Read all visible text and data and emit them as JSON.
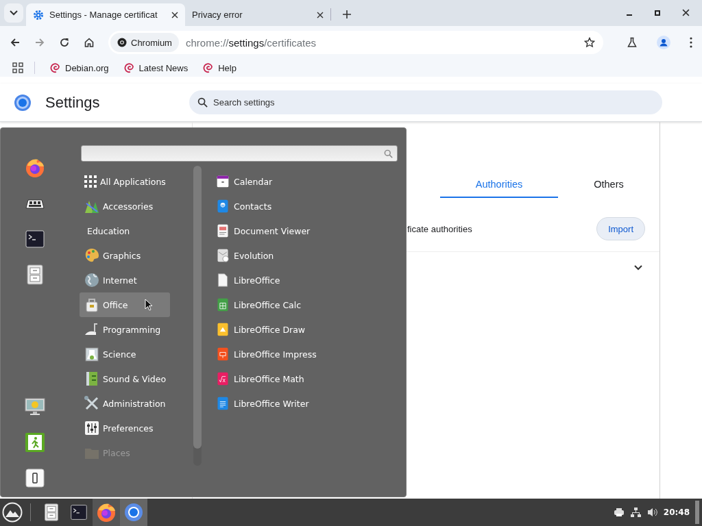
{
  "browser": {
    "tabs": [
      {
        "title": "Settings - Manage certificat",
        "selected": true
      },
      {
        "title": "Privacy error",
        "selected": false
      }
    ],
    "site_chip": "Chromium",
    "url": [
      {
        "text": "chrome://",
        "emphasis": false
      },
      {
        "text": "settings",
        "emphasis": true
      },
      {
        "text": "/certificates",
        "emphasis": false
      }
    ],
    "bookmarks": [
      "Debian.org",
      "Latest News",
      "Help"
    ]
  },
  "settings": {
    "title": "Settings",
    "search": {
      "placeholder": "Search settings"
    },
    "certificate_tabs": [
      {
        "label": "Authorities",
        "selected": true
      },
      {
        "label": "Others",
        "selected": false
      }
    ],
    "description": "ficate authorities",
    "import_button": "Import"
  },
  "menu": {
    "categories": [
      {
        "label": "All Applications",
        "selected": false,
        "disabled": false
      },
      {
        "label": "Accessories",
        "selected": false,
        "disabled": false
      },
      {
        "label": "Education",
        "selected": false,
        "disabled": false
      },
      {
        "label": "Graphics",
        "selected": false,
        "disabled": false
      },
      {
        "label": "Internet",
        "selected": false,
        "disabled": false
      },
      {
        "label": "Office",
        "selected": true,
        "disabled": false
      },
      {
        "label": "Programming",
        "selected": false,
        "disabled": false
      },
      {
        "label": "Science",
        "selected": false,
        "disabled": false
      },
      {
        "label": "Sound & Video",
        "selected": false,
        "disabled": false
      },
      {
        "label": "Administration",
        "selected": false,
        "disabled": false
      },
      {
        "label": "Preferences",
        "selected": false,
        "disabled": false
      },
      {
        "label": "Places",
        "selected": false,
        "disabled": true
      }
    ],
    "apps": [
      "Calendar",
      "Contacts",
      "Document Viewer",
      "Evolution",
      "LibreOffice",
      "LibreOffice Calc",
      "LibreOffice Draw",
      "LibreOffice Impress",
      "LibreOffice Math",
      "LibreOffice Writer"
    ]
  },
  "taskbar": {
    "clock": "20:48"
  }
}
